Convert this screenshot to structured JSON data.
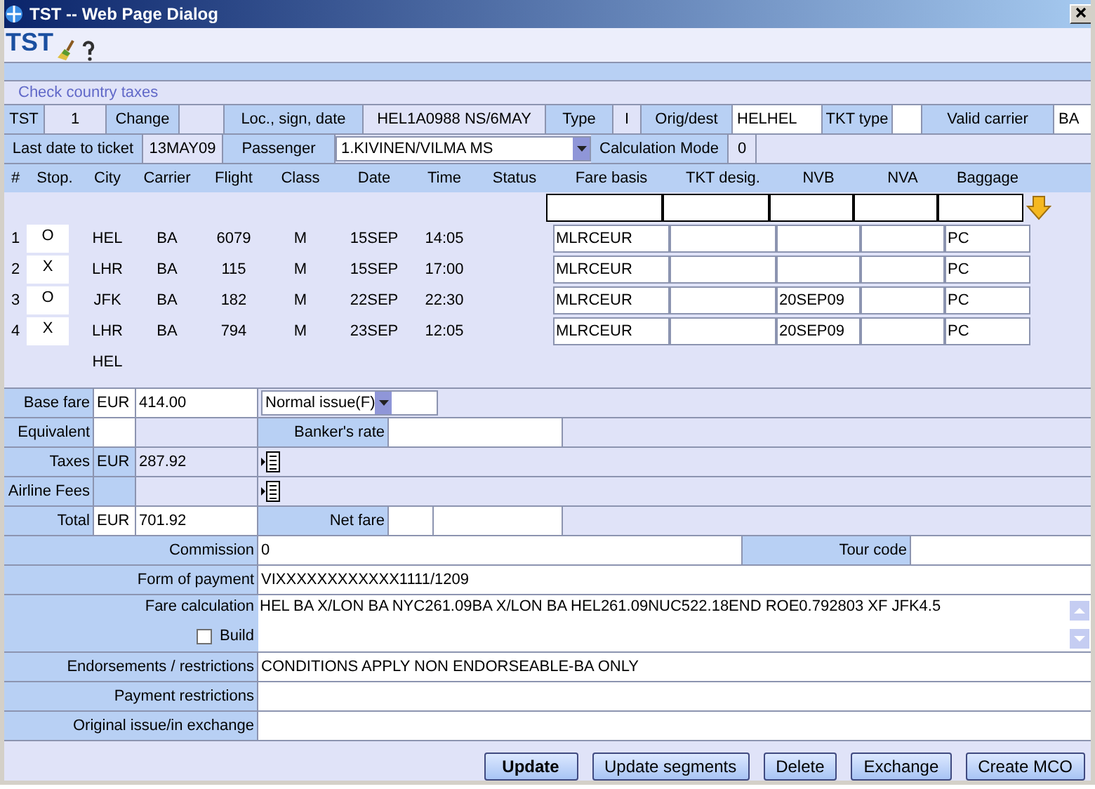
{
  "window": {
    "title": "TST -- Web Page Dialog"
  },
  "header": {
    "title": "TST",
    "link": "Check country taxes"
  },
  "info_rows": [
    [
      {
        "kind": "label",
        "text": "TST"
      },
      {
        "kind": "value",
        "text": "1"
      },
      {
        "kind": "label",
        "text": "Change"
      },
      {
        "kind": "value"
      },
      {
        "kind": "label",
        "text": "Loc., sign, date"
      },
      {
        "kind": "value",
        "text": "HEL1A0988 NS/6MAY"
      },
      {
        "kind": "label",
        "text": "Type"
      },
      {
        "kind": "value",
        "text": "I"
      },
      {
        "kind": "label",
        "text": "Orig/dest"
      },
      {
        "kind": "field",
        "text": "HELHEL"
      },
      {
        "kind": "label",
        "text": "TKT type"
      },
      {
        "kind": "field"
      },
      {
        "kind": "label",
        "text": "Valid carrier"
      },
      {
        "kind": "field",
        "text": "BA"
      }
    ],
    [
      {
        "kind": "label",
        "text": "Last date to ticket"
      },
      {
        "kind": "value",
        "text": "13MAY09"
      },
      {
        "kind": "label",
        "text": "Passenger"
      },
      {
        "kind": "select",
        "text": "1.KIVINEN/VILMA MS"
      },
      {
        "kind": "label",
        "text": "Calculation Mode"
      },
      {
        "kind": "value",
        "text": "0"
      }
    ]
  ],
  "segments": {
    "columns": [
      "#",
      "Stop.",
      "City",
      "Carrier",
      "Flight",
      "Class",
      "Date",
      "Time",
      "Status",
      "Fare basis",
      "TKT desig.",
      "NVB",
      "NVA",
      "Baggage"
    ],
    "rows": [
      {
        "number": "1",
        "stopover": "O",
        "city": "HEL",
        "carrier": "BA",
        "flight": "6079",
        "class": "M",
        "date": "15SEP",
        "time": "14:05",
        "fare_basis": "MLRCEUR",
        "baggage": "PC"
      },
      {
        "number": "2",
        "stopover": "X",
        "city": "LHR",
        "carrier": "BA",
        "flight": "115",
        "class": "M",
        "date": "15SEP",
        "time": "17:00",
        "fare_basis": "MLRCEUR",
        "baggage": "PC"
      },
      {
        "number": "3",
        "stopover": "O",
        "city": "JFK",
        "carrier": "BA",
        "flight": "182",
        "class": "M",
        "date": "22SEP",
        "time": "22:30",
        "fare_basis": "MLRCEUR",
        "nvb": "20SEP09",
        "baggage": "PC"
      },
      {
        "number": "4",
        "stopover": "X",
        "city": "LHR",
        "carrier": "BA",
        "flight": "794",
        "class": "M",
        "date": "23SEP",
        "time": "12:05",
        "fare_basis": "MLRCEUR",
        "nvb": "20SEP09",
        "baggage": "PC"
      }
    ],
    "final_city": "HEL"
  },
  "fare": {
    "base_fare": {
      "label": "Base fare",
      "currency": "EUR",
      "amount": "414.00"
    },
    "issue_select": "Normal issue(F)",
    "equivalent": {
      "label": "Equivalent"
    },
    "bankers_rate": {
      "label": "Banker's rate"
    },
    "taxes": {
      "label": "Taxes",
      "currency": "EUR",
      "amount": "287.92"
    },
    "airline_fees": {
      "label": "Airline Fees"
    },
    "total": {
      "label": "Total",
      "currency": "EUR",
      "amount": "701.92"
    },
    "net_fare": {
      "label": "Net fare"
    }
  },
  "details": {
    "commission": {
      "label": "Commission",
      "value": "0"
    },
    "tour_code": {
      "label": "Tour code"
    },
    "form_of_payment": {
      "label": "Form of payment",
      "value": "VIXXXXXXXXXXXX1111/1209"
    },
    "fare_calculation": {
      "label": "Fare calculation",
      "value": "HEL BA X/LON BA NYC261.09BA X/LON BA HEL261.09NUC522.18END ROE0.792803 XF JFK4.5"
    },
    "build": {
      "label": "Build",
      "checked": false
    },
    "endorsements": {
      "label": "Endorsements / restrictions",
      "value": "CONDITIONS APPLY NON ENDORSEABLE-BA ONLY"
    },
    "payment_restrictions": {
      "label": "Payment restrictions"
    },
    "original_issue": {
      "label": "Original issue/in exchange"
    }
  },
  "buttons": [
    {
      "label": "Update",
      "default": true
    },
    {
      "label": "Update segments",
      "default": false
    },
    {
      "label": "Delete",
      "default": false
    },
    {
      "label": "Exchange",
      "default": false
    },
    {
      "label": "Create MCO",
      "default": false
    }
  ]
}
